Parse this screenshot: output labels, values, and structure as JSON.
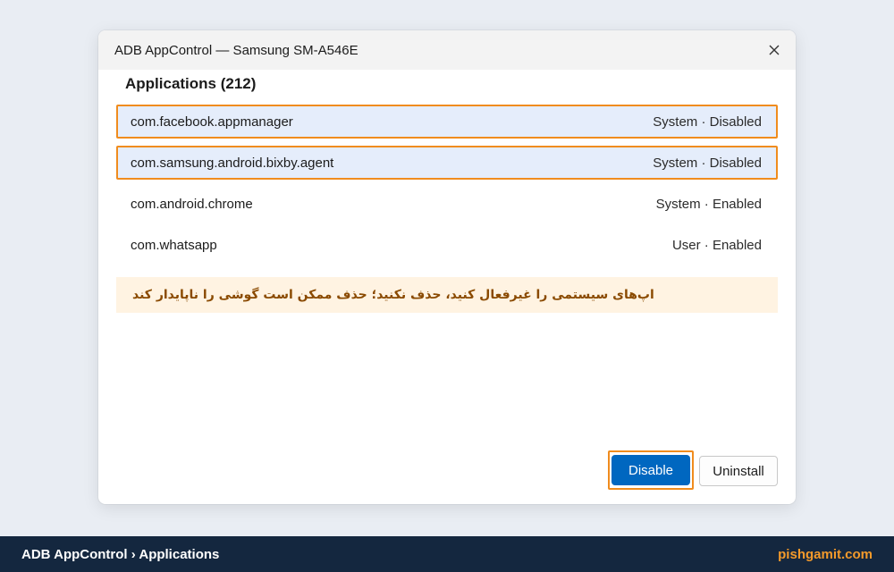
{
  "window": {
    "title": "ADB AppControl — Samsung SM-A546E"
  },
  "section": {
    "title": "Applications (212)"
  },
  "apps": [
    {
      "package": "com.facebook.appmanager",
      "status": "System · Disabled",
      "selected": true
    },
    {
      "package": "com.samsung.android.bixby.agent",
      "status": "System · Disabled",
      "selected": true
    },
    {
      "package": "com.android.chrome",
      "status": "System · Enabled",
      "selected": false
    },
    {
      "package": "com.whatsapp",
      "status": "User · Enabled",
      "selected": false
    }
  ],
  "warning": {
    "text": "اپ‌های سیستمی را غیرفعال کنید، حذف نکنید؛ حذف ممکن است گوشی را ناپایدار کند"
  },
  "buttons": {
    "disable_label": "Disable",
    "uninstall_label": "Uninstall"
  },
  "statusbar": {
    "breadcrumb": "ADB AppControl › Applications",
    "site": "pishgamit.com"
  },
  "icons": {
    "close": "close-icon"
  },
  "colors": {
    "accent": "#0067c0",
    "highlight": "#f08c1e",
    "selected_row": "#e5edfb",
    "warning_bg": "#fff3e2",
    "warning_text": "#8a4a00",
    "statusbar_bg": "#14273f",
    "site_text": "#f39a2b"
  }
}
